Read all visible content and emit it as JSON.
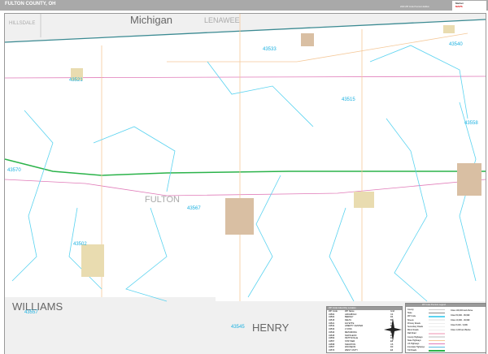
{
  "header": {
    "title": "FULTON COUNTY, OH",
    "edition": "2020 ZIP Code Premium Edition",
    "logo": [
      "Market",
      "MAPS"
    ]
  },
  "map": {
    "state_labels": [
      "Michigan"
    ],
    "county_labels": {
      "hillsdale": "HILLSDALE",
      "lenawee": "LENAWEE",
      "fulton": "FULTON",
      "williams": "WILLIAMS",
      "henry": "HENRY"
    },
    "zip_labels": {
      "z43533": "43533",
      "z43540": "43540",
      "z43521": "43521",
      "z43515": "43515",
      "z43558": "43558",
      "z43570": "43570",
      "z43567": "43567",
      "z43502": "43502",
      "z43557": "43557",
      "z43545": "43545"
    },
    "colors": {
      "zip_boundary": "#5bd3f0",
      "state_line": "#3b8a92",
      "interstate": "#2bb34a",
      "us_highway": "#e07ab8",
      "state_highway": "#f5c99a",
      "city": "#d9bfa3"
    }
  },
  "index": {
    "title": "ZIP Code Index/City Location",
    "headers": [
      "ZIP Code",
      "ZIP Name",
      "Grid"
    ],
    "rows": [
      [
        "43502",
        "ARCHBOLD",
        "C4"
      ],
      [
        "43504",
        "BERKEY",
        "D4"
      ],
      [
        "43515",
        "DELTA",
        "B3"
      ],
      [
        "43521",
        "FAYETTE",
        "C5"
      ],
      [
        "43532",
        "LIBERTY CENTER",
        "E2"
      ],
      [
        "43533",
        "LYONS",
        "B2"
      ],
      [
        "43540",
        "METAMORA",
        "B2"
      ],
      [
        "43545",
        "NAPOLEON",
        "E3"
      ],
      [
        "43553",
        "PETTISVILLE",
        "D4"
      ],
      [
        "43557",
        "STRYKER",
        "E6"
      ],
      [
        "43558",
        "SWANTON",
        "C5"
      ],
      [
        "43567",
        "WAUSEON",
        "D3"
      ],
      [
        "43570",
        "WEST UNITY",
        "E6"
      ]
    ]
  },
  "legend": {
    "title": "ZIP Code Premium Legend",
    "lines": [
      {
        "label": "County",
        "color": "#cccccc"
      },
      {
        "label": "State",
        "color": "#888888"
      },
      {
        "label": "ZIP Code",
        "color": "#5bd3f0"
      },
      {
        "label": "Streets",
        "color": "#eeeeee"
      },
      {
        "label": "Primary Roads",
        "color": "#eeeeee"
      },
      {
        "label": "Secondary Roads",
        "color": "#eeeeee"
      },
      {
        "label": "Minor Roads",
        "color": "#eeeeee"
      },
      {
        "label": "Rail Road",
        "color": "#f7c8d8"
      },
      {
        "label": "County Highways",
        "color": "#dddddd"
      },
      {
        "label": "State Highways",
        "color": "#f5c99a"
      },
      {
        "label": "US Highways",
        "color": "#e07ab8"
      },
      {
        "label": "Interstate Highways",
        "color": "#5bbbe0"
      },
      {
        "label": "Toll Roads",
        "color": "#2bb34a"
      }
    ],
    "cities": [
      "Cities 100,000 and Above",
      "Cities 50,000 - 99,999",
      "Cities 10,000 - 49,999",
      "Cities 5,000 - 9,999",
      "Cities 1,000 and Below"
    ]
  }
}
